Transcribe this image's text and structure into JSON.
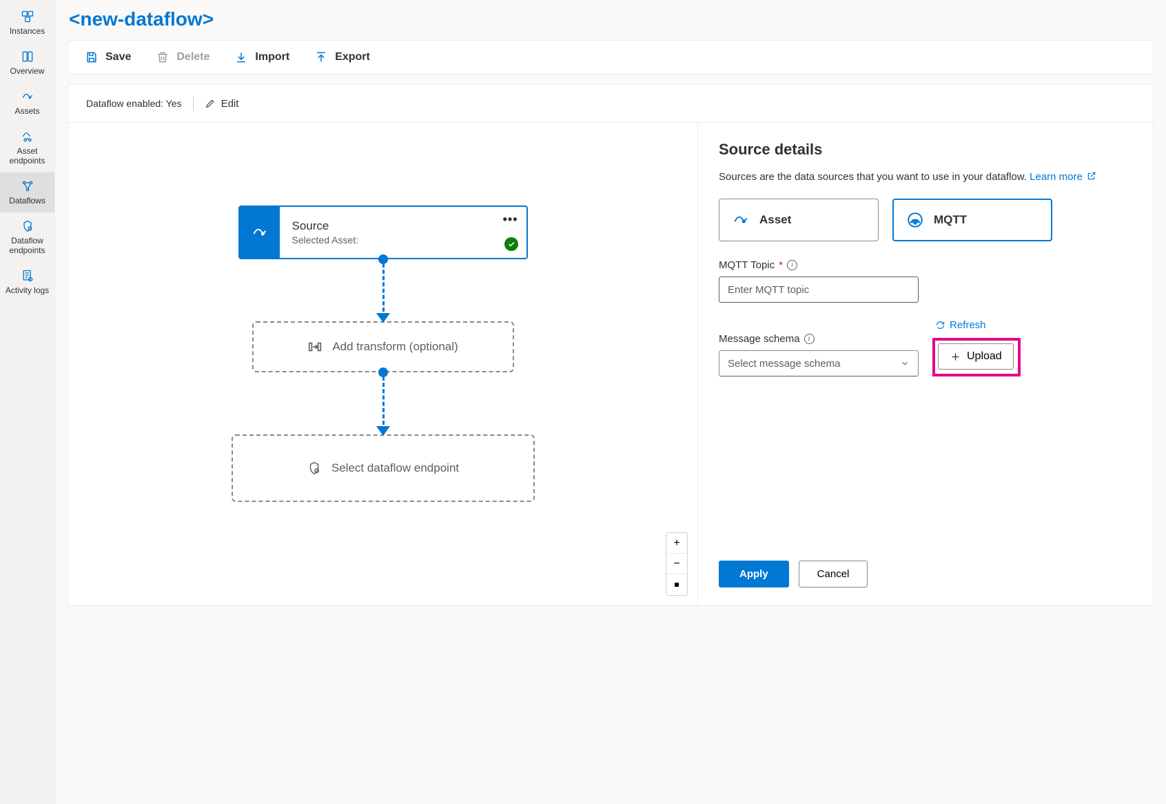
{
  "sidebar": {
    "items": [
      {
        "label": "Instances"
      },
      {
        "label": "Overview"
      },
      {
        "label": "Assets"
      },
      {
        "label": "Asset endpoints"
      },
      {
        "label": "Dataflows"
      },
      {
        "label": "Dataflow endpoints"
      },
      {
        "label": "Activity logs"
      }
    ]
  },
  "page": {
    "title": "<new-dataflow>"
  },
  "toolbar": {
    "save": "Save",
    "delete": "Delete",
    "import": "Import",
    "export": "Export"
  },
  "status": {
    "enabled_label": "Dataflow enabled: Yes",
    "edit": "Edit"
  },
  "canvas": {
    "source_title": "Source",
    "source_subtitle": "Selected Asset:",
    "add_transform": "Add transform (optional)",
    "select_endpoint": "Select dataflow endpoint"
  },
  "details": {
    "heading": "Source details",
    "desc": "Sources are the data sources that you want to use in your dataflow. ",
    "learn_more": "Learn more",
    "type_asset": "Asset",
    "type_mqtt": "MQTT",
    "mqtt_topic_label": "MQTT Topic",
    "mqtt_topic_placeholder": "Enter MQTT topic",
    "schema_label": "Message schema",
    "schema_placeholder": "Select message schema",
    "refresh": "Refresh",
    "upload": "Upload",
    "apply": "Apply",
    "cancel": "Cancel"
  }
}
